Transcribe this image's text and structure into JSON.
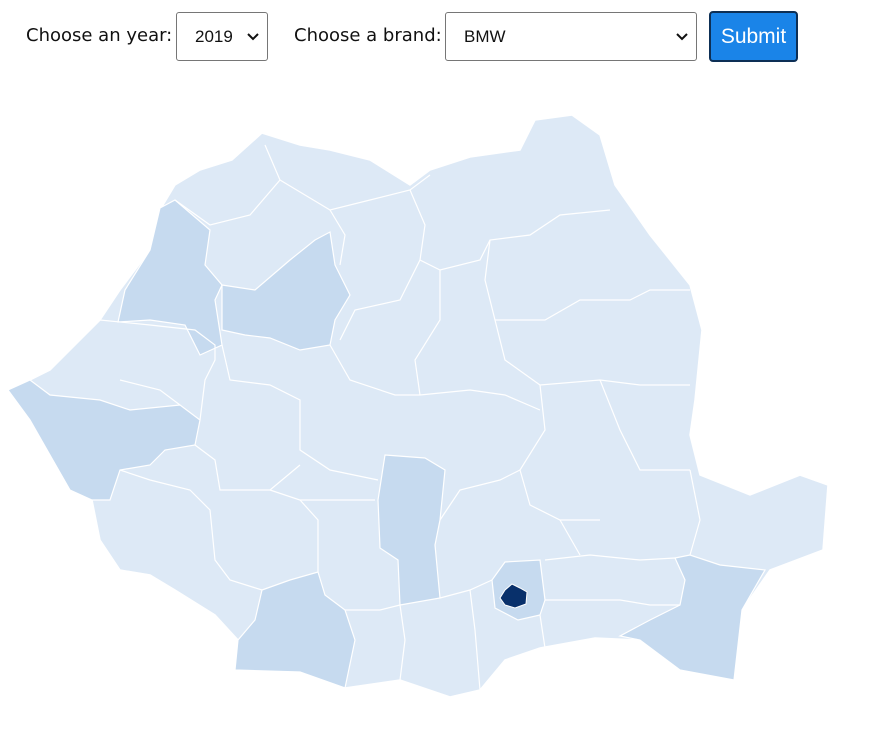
{
  "form": {
    "year_label": "Choose an year:",
    "year_value": "2019",
    "brand_label": "Choose a brand:",
    "brand_value": "BMW",
    "submit_label": "Submit"
  },
  "map": {
    "region": "Romania",
    "scale_colors": {
      "lowest": "#dde9f6",
      "low": "#c6daef",
      "highest": "#08306b"
    },
    "border_color": "#ffffff"
  }
}
